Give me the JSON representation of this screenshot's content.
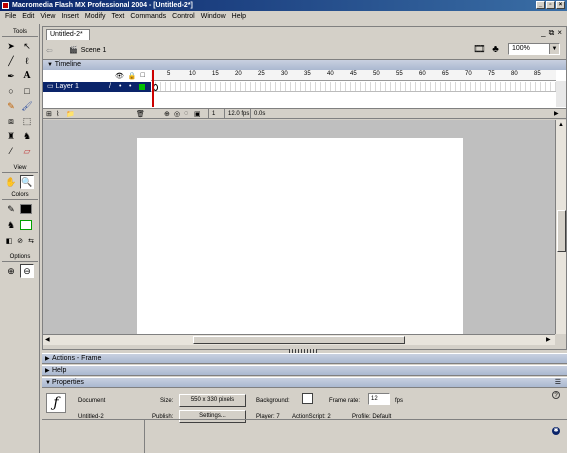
{
  "window": {
    "title": "Macromedia Flash MX Professional 2004 - [Untitled-2*]"
  },
  "menu": [
    "File",
    "Edit",
    "View",
    "Insert",
    "Modify",
    "Text",
    "Commands",
    "Control",
    "Window",
    "Help"
  ],
  "tools": {
    "header": "Tools",
    "view_header": "View",
    "colors_header": "Colors",
    "options_header": "Options"
  },
  "document": {
    "tab": "Untitled-2*",
    "scene": "Scene 1",
    "zoom": "100%"
  },
  "timeline": {
    "header": "Timeline",
    "layer": "Layer 1",
    "ruler": [
      "5",
      "10",
      "15",
      "20",
      "25",
      "30",
      "35",
      "40",
      "45",
      "50",
      "55",
      "60",
      "65",
      "70",
      "75",
      "80",
      "85"
    ],
    "current_frame": "1",
    "frame_rate": "12.0 fps",
    "elapsed": "0.0s"
  },
  "panels": {
    "actions": "Actions - Frame",
    "help": "Help",
    "properties": "Properties"
  },
  "properties": {
    "doc_type": "Document",
    "doc_name": "Untitled-2",
    "size_label": "Size:",
    "size_value": "550 x 330 pixels",
    "background_label": "Background:",
    "background_color": "#ffffff",
    "frame_rate_label": "Frame rate:",
    "frame_rate_value": "12",
    "fps_label": "fps",
    "publish_label": "Publish:",
    "settings_button": "Settings...",
    "player": "Player: 7",
    "actionscript": "ActionScript: 2",
    "profile": "Profile: Default"
  }
}
